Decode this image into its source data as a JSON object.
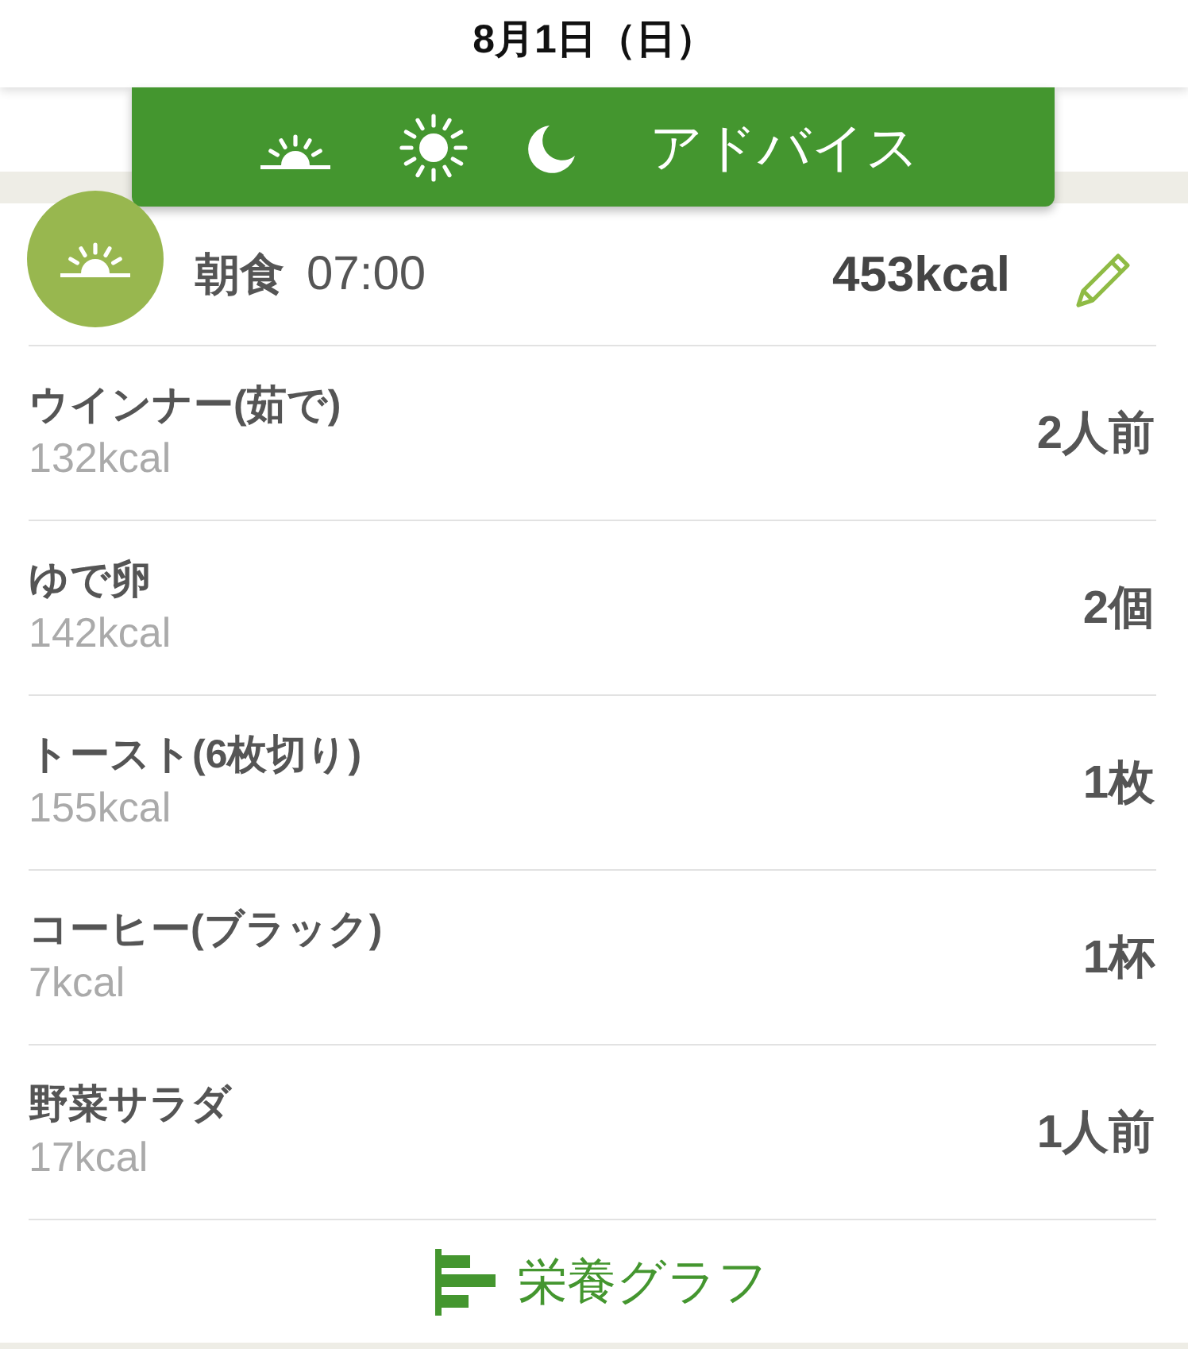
{
  "header": {
    "title": "8月1日（日）"
  },
  "toolbar": {
    "advice_label": "アドバイス"
  },
  "meal": {
    "name": "朝食",
    "time": "07:00",
    "total": "453kcal"
  },
  "foods": [
    {
      "name": "ウインナー(茹で)",
      "kcal": "132kcal",
      "quantity": "2人前"
    },
    {
      "name": "ゆで卵",
      "kcal": "142kcal",
      "quantity": "2個"
    },
    {
      "name": "トースト(6枚切り)",
      "kcal": "155kcal",
      "quantity": "1枚"
    },
    {
      "name": "コーヒー(ブラック)",
      "kcal": "7kcal",
      "quantity": "1杯"
    },
    {
      "name": "野菜サラダ",
      "kcal": "17kcal",
      "quantity": "1人前"
    }
  ],
  "footer_link": {
    "label": "栄養グラフ"
  }
}
